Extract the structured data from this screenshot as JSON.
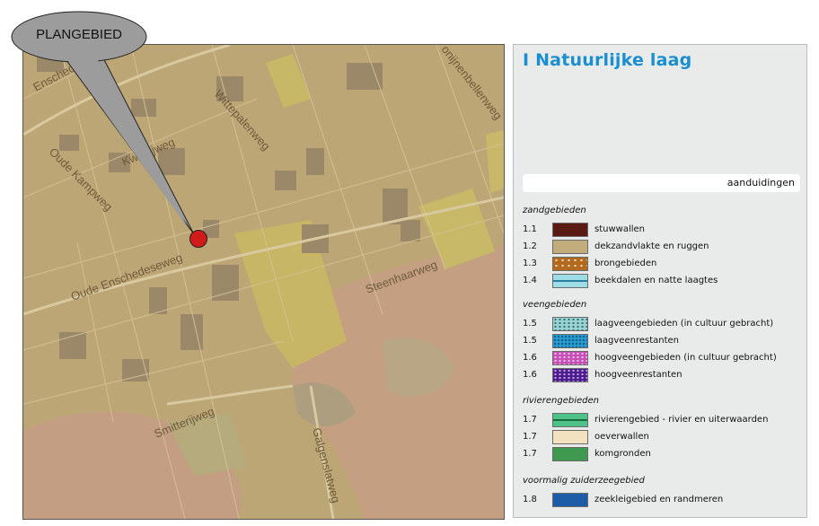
{
  "map": {
    "colors": {
      "base": "#bda676",
      "grass": "#c6b56a",
      "dark_sand": "#a48e66",
      "pink": "#c9a189",
      "green_pale": "#b7ad7b"
    },
    "road_labels": {
      "enschedeseweg_top": "Enschedeseweg",
      "kwierijweg": "Kwierijweg",
      "wittepalenweg": "Wittepalenweg",
      "oude_kampweg": "Oude Kampweg",
      "oude_enschedeseweg": "Oude Enschedeseweg",
      "steenhaarweg": "Steenhaarweg",
      "smitterijweg": "Smitterijweg",
      "galgenslatweg": "Galgenslatweg",
      "konijnenbellenweg": "onijnenbellenweg"
    },
    "callout_label": "PLANGEBIED",
    "marker_color": "#d11a1a"
  },
  "legend": {
    "title": "I Natuurlijke laag",
    "header": "aanduidingen",
    "title_color": "#1a8fd0",
    "groups": [
      {
        "name": "zandgebieden",
        "items": [
          {
            "num": "1.1",
            "label": "stuwwallen",
            "color": "#5b1a12"
          },
          {
            "num": "1.2",
            "label": "dekzandvlakte en ruggen",
            "color": "#c3ac7c"
          },
          {
            "num": "1.3",
            "label": "brongebieden",
            "color": "#b36a1f"
          },
          {
            "num": "1.4",
            "label": "beekdalen en natte laagtes",
            "color": "#9fdde6"
          }
        ]
      },
      {
        "name": "veengebieden",
        "items": [
          {
            "num": "1.5",
            "label": "laagveengebieden (in cultuur gebracht)",
            "color": "#7cc2bf"
          },
          {
            "num": "1.5",
            "label": "laagveenrestanten",
            "color": "#2b9ed1"
          },
          {
            "num": "1.6",
            "label": "hoogveengebieden (in cultuur gebracht)",
            "color": "#c54fb7"
          },
          {
            "num": "1.6",
            "label": "hoogveenrestanten",
            "color": "#4a1c8c"
          }
        ]
      },
      {
        "name": "rivierengebieden",
        "items": [
          {
            "num": "1.7",
            "label": "rivierengebied - rivier en uiterwaarden",
            "color": "#4fc28a"
          },
          {
            "num": "1.7",
            "label": "oeverwallen",
            "color": "#f2e2c0"
          },
          {
            "num": "1.7",
            "label": "komgronden",
            "color": "#3f9a4f"
          }
        ]
      },
      {
        "name": "voormalig zuiderzeegebied",
        "items": [
          {
            "num": "1.8",
            "label": "zeekleigebied en randmeren",
            "color": "#1f5ca8"
          }
        ]
      }
    ]
  }
}
